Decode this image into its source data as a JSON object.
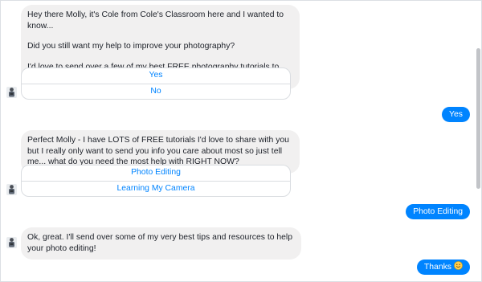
{
  "conversation": {
    "msg1": {
      "paragraphs": [
        "Hey there Molly, it's Cole from Cole's Classroom here and I wanted to know...",
        "Did you still want my help to improve your photography?",
        "I'd love to send over a few of my best FREE photography tutorials to you, if that's ok."
      ],
      "buttons": [
        "Yes",
        "No"
      ]
    },
    "reply1": "Yes",
    "msg2": {
      "text": "Perfect Molly - I have LOTS of FREE tutorials I'd love to share with you but I really only want to send you info you care about most so just tell me... what do you need the most help with RIGHT NOW?",
      "buttons": [
        "Photo Editing",
        "Learning My Camera"
      ]
    },
    "reply2": "Photo Editing",
    "msg3": {
      "text": "Ok, great.  I'll send over some of my very best tips and resources to help your photo editing!"
    },
    "reply3": "Thanks",
    "reply3_emoji": "smiling-face-emoji"
  },
  "colors": {
    "incoming_bubble": "#f1f0f0",
    "outgoing_bubble": "#0084ff",
    "quick_reply_text": "#0084ff"
  }
}
